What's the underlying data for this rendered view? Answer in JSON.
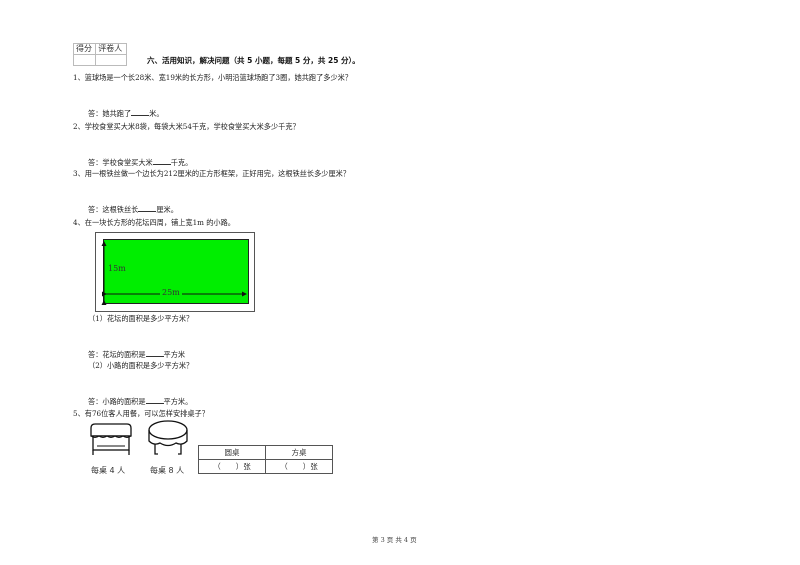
{
  "score_box": {
    "score_label": "得分",
    "reviewer_label": "评卷人"
  },
  "section_title": "六、活用知识，解决问题（共 5 小题，每题 5 分，共 25 分）。",
  "questions": [
    {
      "text": "1、篮球场是一个长28米、宽19米的长方形，小明沿篮球场跑了3圈，她共跑了多少米？",
      "answer_prefix": "答：她共跑了",
      "answer_suffix": "米。"
    },
    {
      "text": "2、学校食堂买大米8袋，每袋大米54千克，学校食堂买大米多少千克？",
      "answer_prefix": "答：学校食堂买大米",
      "answer_suffix": "千克。"
    },
    {
      "text": "3、用一根铁丝做一个边长为212厘米的正方形框架，正好用完，这根铁丝长多少厘米？",
      "answer_prefix": "答：这根铁丝长",
      "answer_suffix": "厘米。"
    },
    {
      "text": "4、在一块长方形的花坛四周，铺上宽1m 的小路。",
      "diagram": {
        "height_label": "15m",
        "width_label": "25m",
        "fill_color": "#00ee00"
      },
      "sub": [
        {
          "text": "（1）花坛的面积是多少平方米？",
          "answer_prefix": "答：花坛的面积是",
          "answer_suffix": "平方米"
        },
        {
          "text": "（2）小路的面积是多少平方米？",
          "answer_prefix": "答：小路的面积是",
          "answer_suffix": "平方米。"
        }
      ]
    },
    {
      "text": "5、有76位客人用餐，可以怎样安排桌子？",
      "square_table_caption": "每桌 4 人",
      "round_table_caption": "每桌 8 人",
      "table_headers": [
        "圆桌",
        "方桌"
      ],
      "table_cells": [
        "（　　）张",
        "（　　）张"
      ]
    }
  ],
  "footer": "第 3 页 共 4 页"
}
